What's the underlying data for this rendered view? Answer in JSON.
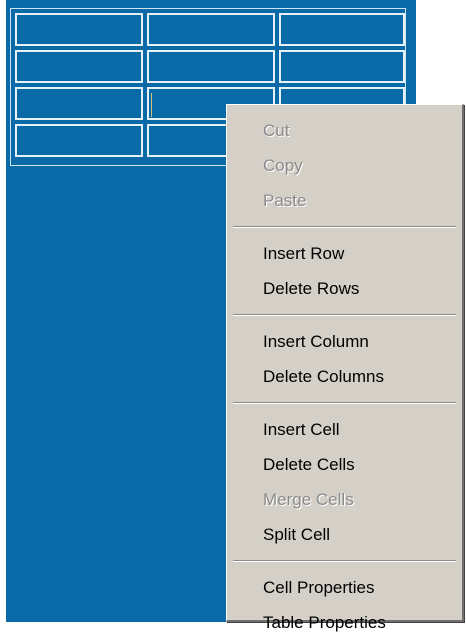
{
  "context_menu": {
    "items": [
      {
        "label": "Cut",
        "enabled": false
      },
      {
        "label": "Copy",
        "enabled": false
      },
      {
        "label": "Paste",
        "enabled": false
      },
      {
        "label": "Insert Row",
        "enabled": true
      },
      {
        "label": "Delete Rows",
        "enabled": true
      },
      {
        "label": "Insert Column",
        "enabled": true
      },
      {
        "label": "Delete Columns",
        "enabled": true
      },
      {
        "label": "Insert Cell",
        "enabled": true
      },
      {
        "label": "Delete Cells",
        "enabled": true
      },
      {
        "label": "Merge Cells",
        "enabled": false
      },
      {
        "label": "Split Cell",
        "enabled": true
      },
      {
        "label": "Cell Properties",
        "enabled": true
      },
      {
        "label": "Table Properties",
        "enabled": true
      }
    ]
  },
  "colors": {
    "canvas_background": "#0a6aa8",
    "menu_background": "#d4d0c8",
    "disabled_text": "#8b8b8b",
    "cell_border": "#e7f0f7",
    "caret": "#d1c27a"
  }
}
